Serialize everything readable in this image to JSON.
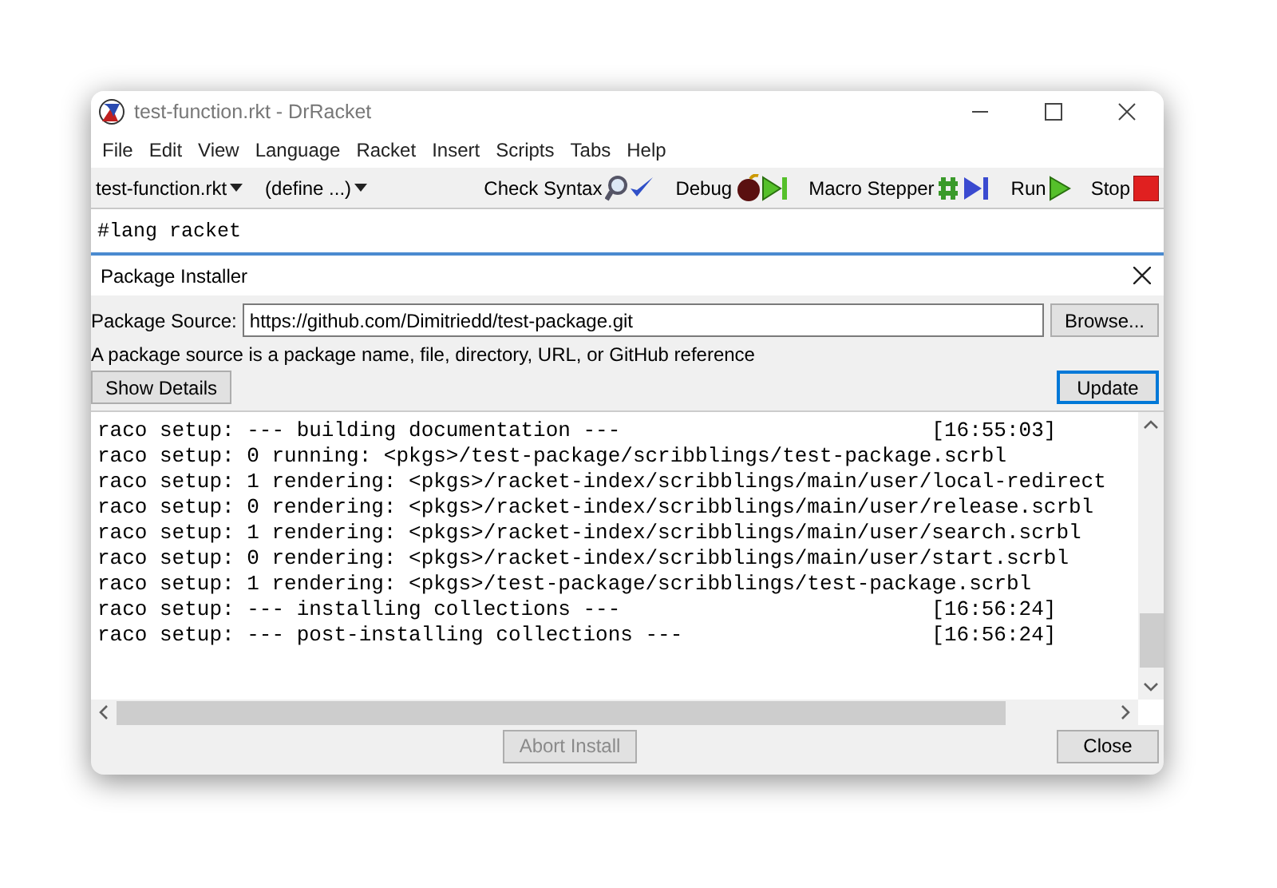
{
  "window": {
    "title": "test-function.rkt - DrRacket"
  },
  "menu": [
    "File",
    "Edit",
    "View",
    "Language",
    "Racket",
    "Insert",
    "Scripts",
    "Tabs",
    "Help"
  ],
  "toolbar": {
    "file_menu": "test-function.rkt",
    "define_menu": "(define ...)",
    "buttons": [
      {
        "label": "Check Syntax",
        "kind": "check_syntax"
      },
      {
        "label": "Debug",
        "kind": "debug"
      },
      {
        "label": "Macro Stepper",
        "kind": "macro_stepper"
      },
      {
        "label": "Run",
        "kind": "run"
      },
      {
        "label": "Stop",
        "kind": "stop"
      }
    ]
  },
  "editor": {
    "code": "#lang racket"
  },
  "package_installer": {
    "title": "Package Installer",
    "source_label": "Package Source:",
    "source_value": "https://github.com/Dimitriedd/test-package.git",
    "browse_button": "Browse...",
    "hint": "A package source is a package name, file, directory, URL, or GitHub reference",
    "show_details_button": {
      "label": "Show Details",
      "default": false
    },
    "update_button": {
      "label": "Update",
      "default": true
    },
    "log": [
      {
        "text": "raco setup: --- building documentation ---",
        "time": "[16:55:03]"
      },
      {
        "text": "raco setup: 0 running: <pkgs>/test-package/scribblings/test-package.scrbl"
      },
      {
        "text": "raco setup: 1 rendering: <pkgs>/racket-index/scribblings/main/user/local-redirect"
      },
      {
        "text": "raco setup: 0 rendering: <pkgs>/racket-index/scribblings/main/user/release.scrbl"
      },
      {
        "text": "raco setup: 1 rendering: <pkgs>/racket-index/scribblings/main/user/search.scrbl"
      },
      {
        "text": "raco setup: 0 rendering: <pkgs>/racket-index/scribblings/main/user/start.scrbl"
      },
      {
        "text": "raco setup: 1 rendering: <pkgs>/test-package/scribblings/test-package.scrbl"
      },
      {
        "text": "raco setup: --- installing collections ---",
        "time": "[16:56:24]"
      },
      {
        "text": "raco setup: --- post-installing collections ---",
        "time": "[16:56:24]"
      }
    ],
    "abort_button": {
      "label": "Abort Install",
      "disabled": true
    },
    "close_button": {
      "label": "Close",
      "disabled": false
    }
  }
}
